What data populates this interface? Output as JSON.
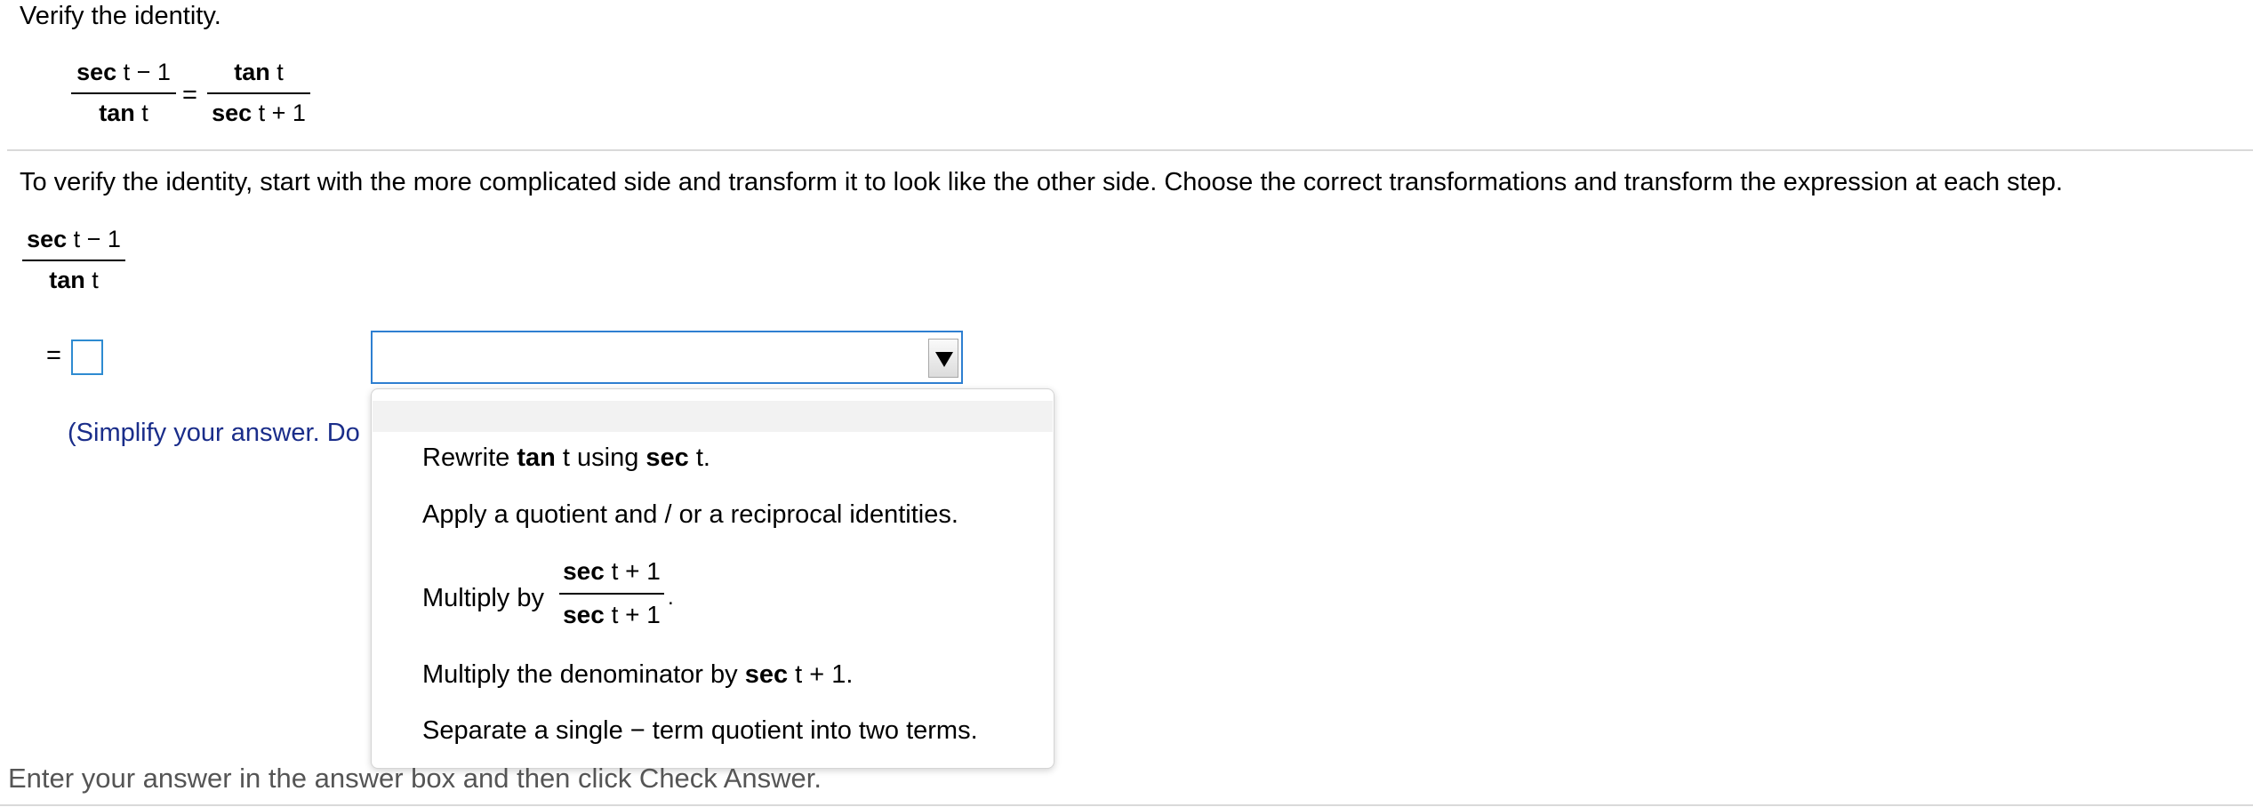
{
  "header": {
    "title": "Verify the identity."
  },
  "identity": {
    "lhs": {
      "num_fn": "sec",
      "num_rest": "t − 1",
      "den_fn": "tan",
      "den_rest": "t"
    },
    "eq": "=",
    "rhs": {
      "num_fn": "tan",
      "num_rest": "t",
      "den_fn": "sec",
      "den_rest": "t + 1"
    }
  },
  "instructions": "To verify the identity, start with the more complicated side and transform it to look like the other side. Choose the correct transformations and transform the expression at each step.",
  "work": {
    "start": {
      "num_fn": "sec",
      "num_rest": "t − 1",
      "den_fn": "tan",
      "den_rest": "t"
    },
    "eq": "=",
    "hint": "(Simplify your answer. Do",
    "answer_value": "",
    "select_value": ""
  },
  "dropdown": {
    "options": {
      "o1": {
        "a": "Rewrite ",
        "b": "tan",
        "c": " t using ",
        "d": "sec",
        "e": " t."
      },
      "o2": {
        "text": "Apply a quotient and / or a reciprocal identities."
      },
      "o3": {
        "prefix": "Multiply by",
        "num_fn": "sec",
        "num_rest": " t + 1",
        "den_fn": "sec",
        "den_rest": " t + 1",
        "suffix": "."
      },
      "o4": {
        "a": "Multiply the denominator by ",
        "b": "sec",
        "c": " t + 1."
      },
      "o5": {
        "text": "Separate a single − term quotient into two terms."
      }
    }
  },
  "footer": {
    "text": "Enter your answer in the answer box and then click Check Answer."
  },
  "colors": {
    "accent": "#2e8bd1",
    "hint": "#1a2d8a",
    "separator": "#d9d9d9"
  }
}
